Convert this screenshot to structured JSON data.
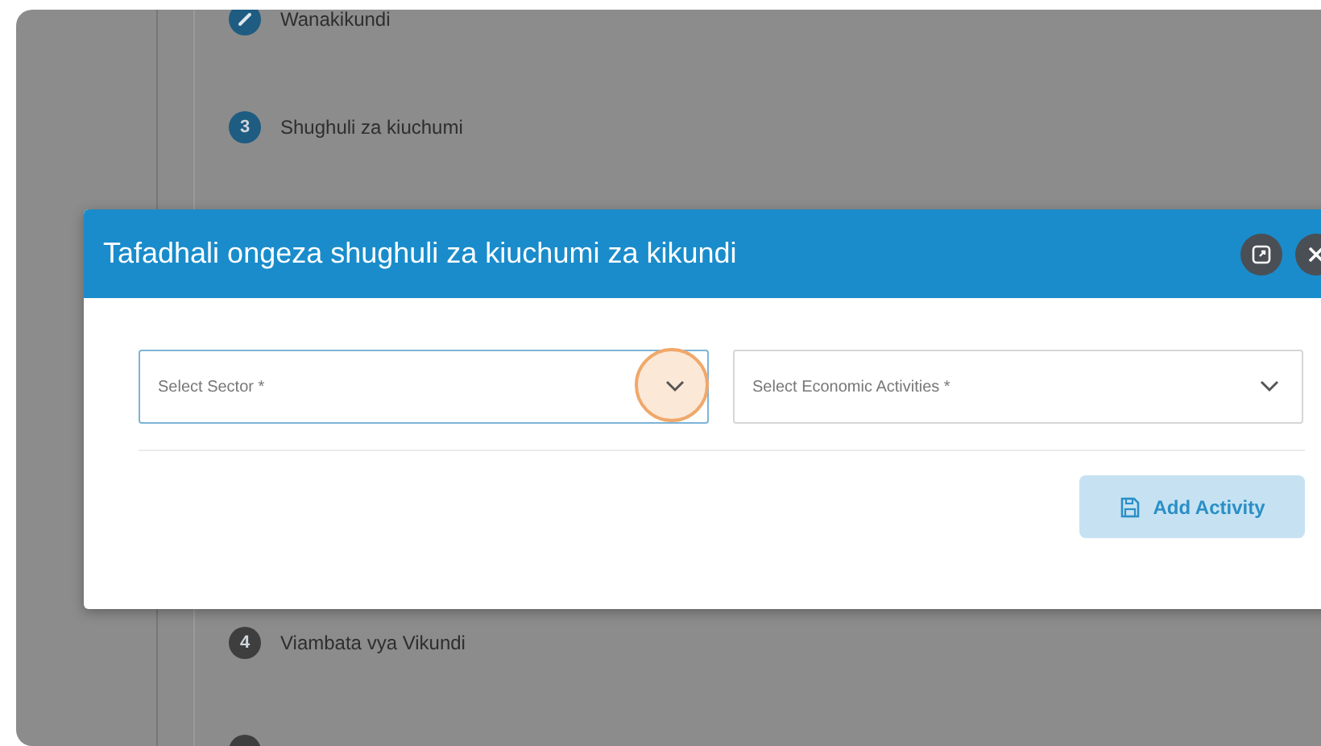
{
  "steps": [
    {
      "kind": "edit",
      "label": "Wanakikundi",
      "active": true
    },
    {
      "kind": "number",
      "number": "3",
      "label": "Shughuli za kiuchumi",
      "active": true
    },
    {
      "kind": "number",
      "number": "4",
      "label": "Viambata vya Vikundi",
      "active": false
    },
    {
      "kind": "number",
      "active": false
    }
  ],
  "dialog": {
    "title": "Tafadhali ongeza shughuli za kiuchumi za kikundi",
    "fields": [
      {
        "placeholder": "Select Sector *",
        "focused": true
      },
      {
        "placeholder": "Select Economic Activities *",
        "focused": false
      }
    ],
    "button": "Add Activity"
  }
}
